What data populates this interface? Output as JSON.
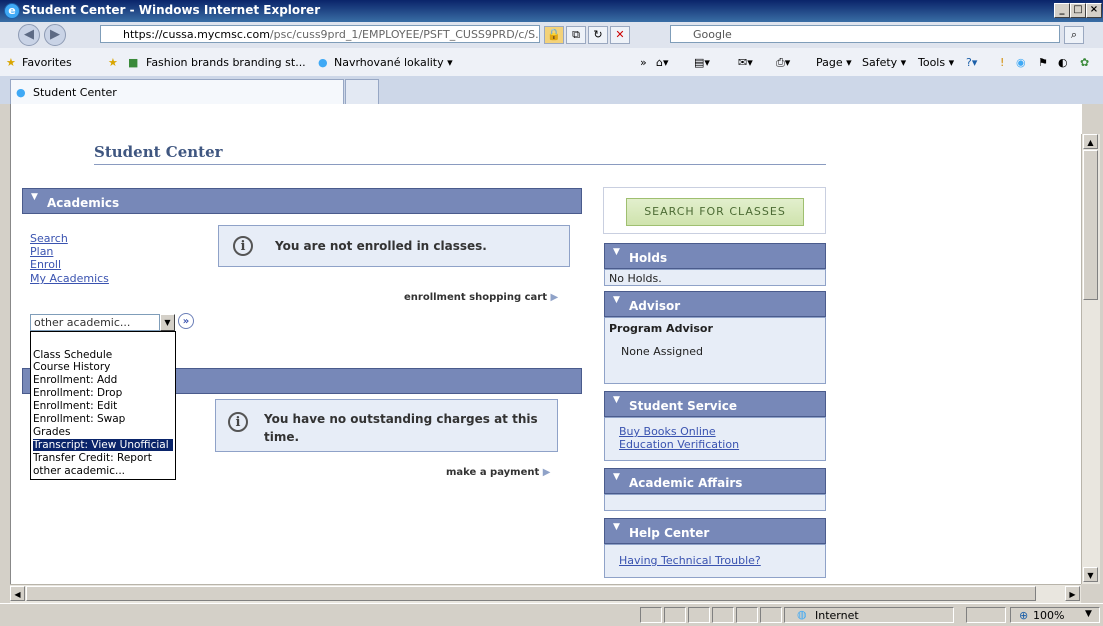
{
  "window": {
    "title": "Student Center - Windows Internet Explorer",
    "minimize_glyph": "_",
    "maximize_glyph": "□",
    "close_glyph": "×"
  },
  "browser": {
    "back_glyph": "◀",
    "forward_glyph": "▶",
    "address_domain": "https://cussa.mycmsc.com",
    "address_path": "/psc/cuss9prd_1/EMPLOYEE/PSFT_CUSS9PRD/c/S.",
    "search_placeholder": "Google",
    "favorites_label": "Favorites",
    "fav_link_1": "Fashion brands branding st...",
    "fav_link_2": "Navrhované lokality ▾",
    "toolbar_page": "Page ▾",
    "toolbar_safety": "Safety ▾",
    "toolbar_tools": "Tools ▾",
    "toolbar_help": "?▾",
    "tab_label": "Student Center"
  },
  "page": {
    "title": "Student Center"
  },
  "academics": {
    "header": "Academics",
    "links": [
      "Search",
      "Plan",
      "Enroll",
      "My Academics"
    ],
    "message": "You are not enrolled in classes.",
    "cart_link": "enrollment shopping cart",
    "select_value": "other academic...",
    "go_glyph": "»",
    "options": [
      "Class Schedule",
      "Course History",
      "Enrollment: Add",
      "Enrollment: Drop",
      "Enrollment: Edit",
      "Enrollment: Swap",
      "Grades",
      "Transcript: View Unofficial",
      "Transfer Credit: Report",
      "other academic..."
    ],
    "selected_option_index": 7
  },
  "finances": {
    "message_line1": "You have no outstanding charges at this",
    "message_line2": "time.",
    "payment_link": "make a payment"
  },
  "sidebar": {
    "search_button": "SEARCH FOR CLASSES",
    "holds": {
      "header": "Holds",
      "text": "No Holds."
    },
    "advisor": {
      "header": "Advisor",
      "label": "Program Advisor",
      "text": "None Assigned"
    },
    "student_service": {
      "header": "Student Service",
      "links": [
        "Buy Books Online",
        "Education Verification"
      ]
    },
    "academic_affairs": {
      "header": "Academic Affairs"
    },
    "help_center": {
      "header": "Help Center",
      "link": "Having Technical Trouble?"
    }
  },
  "status": {
    "zone": "Internet",
    "zoom": "100%"
  },
  "colors": {
    "section_header": "#7788b8",
    "info_box": "#e7edf7",
    "link": "#3a53b0",
    "title_bar": "#0a246a"
  }
}
